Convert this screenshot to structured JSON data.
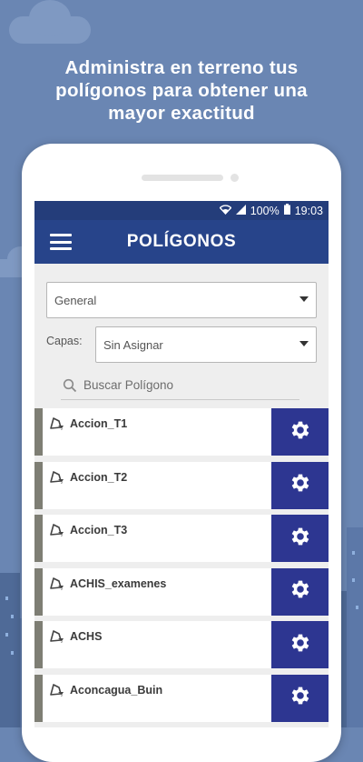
{
  "headline": {
    "line1": "Administra en terreno tus",
    "line2": "polígonos para obtener una",
    "line3": "mayor exactitud"
  },
  "status_bar": {
    "battery": "100%",
    "time": "19:03"
  },
  "app_bar": {
    "title": "POLÍGONOS"
  },
  "filters": {
    "category_value": "General",
    "capas_label": "Capas:",
    "capas_value": "Sin Asignar"
  },
  "search": {
    "placeholder": "Buscar Polígono"
  },
  "polygons": [
    {
      "name": "Accion_T1"
    },
    {
      "name": "Accion_T2"
    },
    {
      "name": "Accion_T3"
    },
    {
      "name": "ACHIS_examenes"
    },
    {
      "name": "ACHS"
    },
    {
      "name": "Aconcagua_Buin"
    }
  ],
  "colors": {
    "background": "#6a86b3",
    "app_bar": "#27448a",
    "status_bar": "#243d7a",
    "settings_button": "#2d3691",
    "row_accent": "#7e7e74"
  }
}
